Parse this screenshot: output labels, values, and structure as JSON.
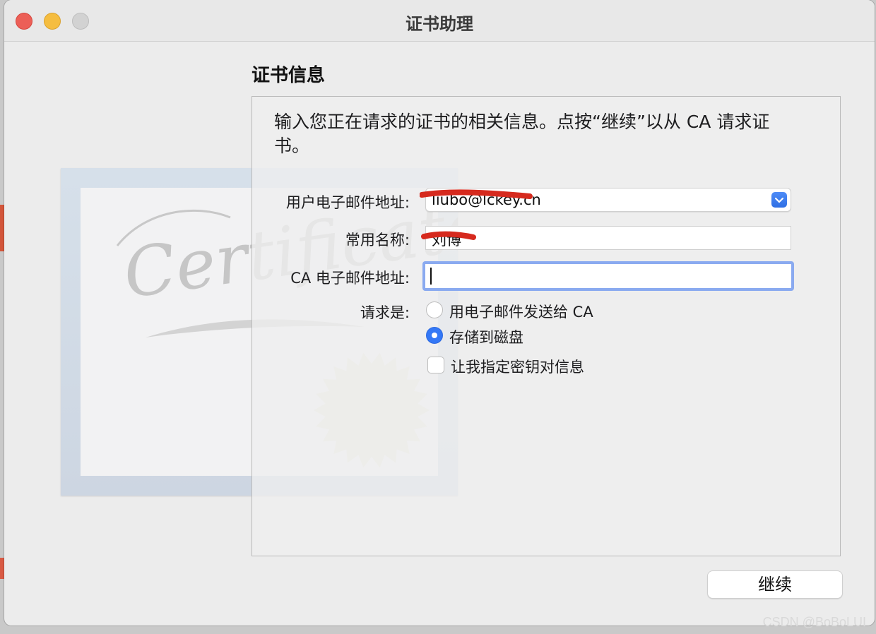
{
  "window": {
    "title": "证书助理"
  },
  "section": {
    "title": "证书信息"
  },
  "description": "输入您正在请求的证书的相关信息。点按“继续”以从 CA 请求证书。",
  "form": {
    "email_label": "用户电子邮件地址:",
    "email_value": "liubo@lckey.cn",
    "common_name_label": "常用名称:",
    "common_name_value": "刘博",
    "ca_email_label": "CA 电子邮件地址:",
    "ca_email_value": "",
    "request_label": "请求是:",
    "options": [
      {
        "label": "用电子邮件发送给 CA",
        "selected": false
      },
      {
        "label": "存储到磁盘",
        "selected": true
      }
    ],
    "key_pair_label": "让我指定密钥对信息",
    "key_pair_checked": false
  },
  "illustration": {
    "text": "Certificate"
  },
  "buttons": {
    "continue": "继续"
  },
  "watermark": "CSDN @BoBoLUI",
  "colors": {
    "accent": "#3478f6",
    "focus_ring": "#8aaaf0",
    "redaction": "#d62a1e"
  }
}
